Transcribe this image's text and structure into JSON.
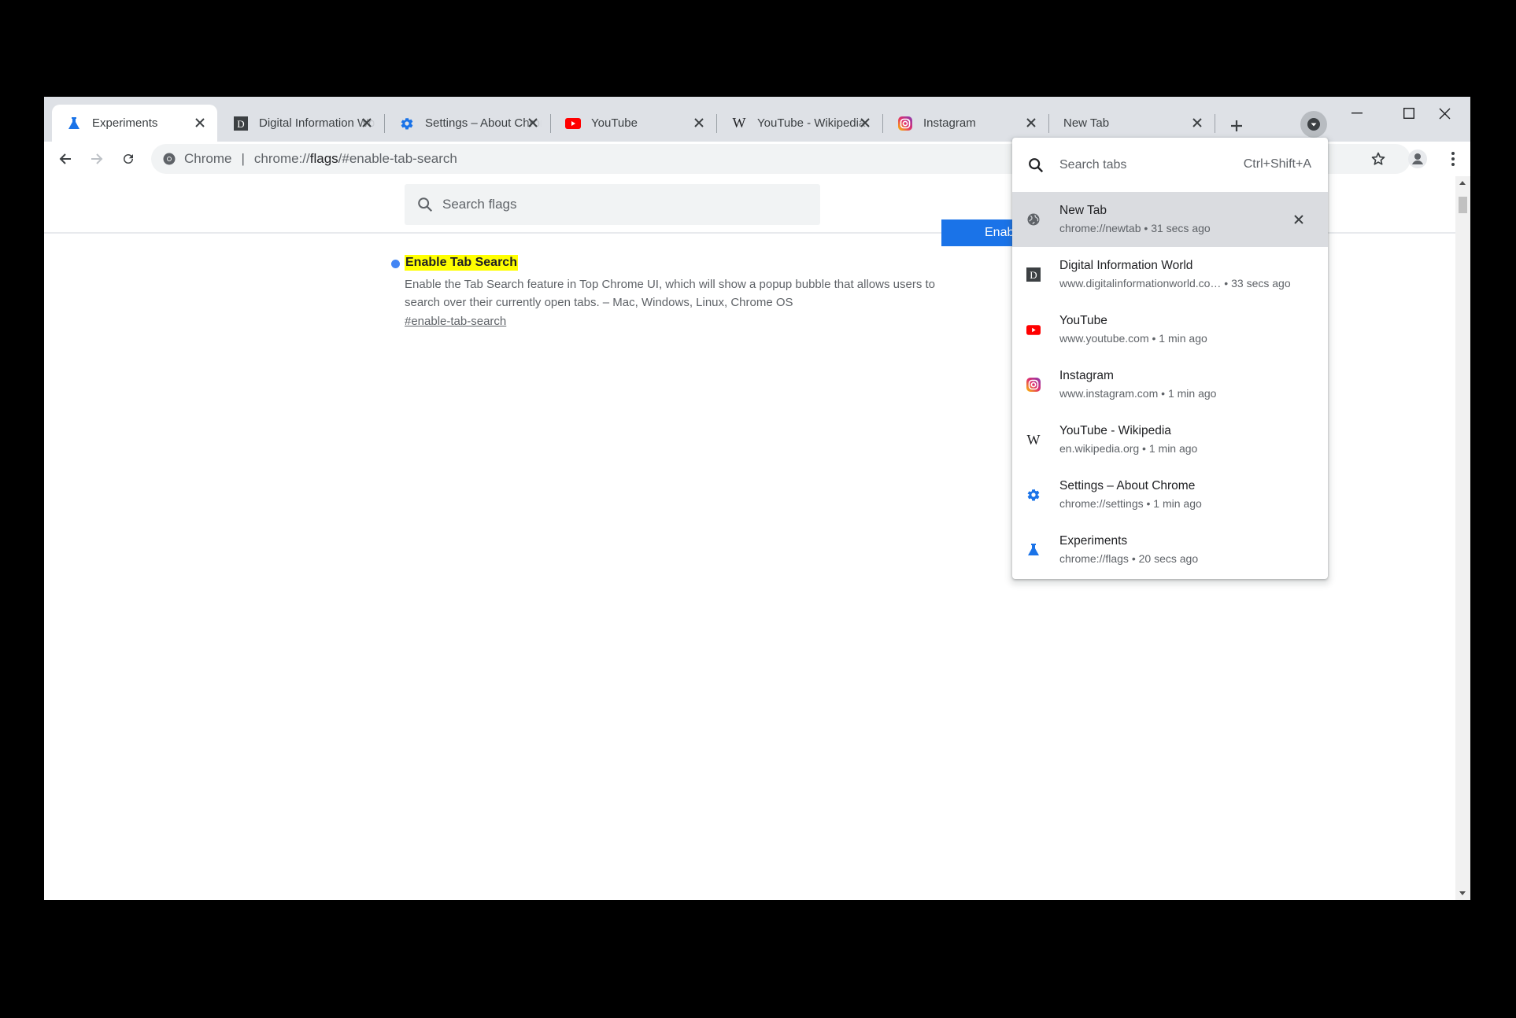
{
  "tabs": [
    {
      "title": "Experiments",
      "icon": "flask-icon",
      "active": true
    },
    {
      "title": "Digital Information World",
      "icon": "dgiw-icon"
    },
    {
      "title": "Settings – About Chrome",
      "icon": "gear-icon"
    },
    {
      "title": "YouTube",
      "icon": "youtube-icon"
    },
    {
      "title": "YouTube - Wikipedia",
      "icon": "wikipedia-icon"
    },
    {
      "title": "Instagram",
      "icon": "instagram-icon"
    },
    {
      "title": "New Tab",
      "icon": "none"
    }
  ],
  "omnibox": {
    "chip": "Chrome",
    "separator": "|",
    "url_prefix": "chrome://",
    "url_host": "flags",
    "url_suffix": "/#enable-tab-search"
  },
  "flags": {
    "search_placeholder": "Search flags",
    "entry": {
      "title": "Enable Tab Search",
      "description": "Enable the Tab Search feature in Top Chrome UI, which will show a popup bubble that allows users to search over their currently open tabs. – Mac, Windows, Linux, Chrome OS",
      "link": "#enable-tab-search",
      "select_value": "Enabled"
    }
  },
  "tab_search": {
    "placeholder": "Search tabs",
    "shortcut": "Ctrl+Shift+A",
    "results": [
      {
        "title": "New Tab",
        "url": "chrome://newtab",
        "time": "31 secs ago",
        "icon": "globe-icon",
        "selected": true
      },
      {
        "title": "Digital Information World",
        "url": "www.digitalinformationworld.co…",
        "time": "33 secs ago",
        "icon": "dgiw-icon"
      },
      {
        "title": "YouTube",
        "url": "www.youtube.com",
        "time": "1 min ago",
        "icon": "youtube-icon"
      },
      {
        "title": "Instagram",
        "url": "www.instagram.com",
        "time": "1 min ago",
        "icon": "instagram-icon"
      },
      {
        "title": "YouTube - Wikipedia",
        "url": "en.wikipedia.org",
        "time": "1 min ago",
        "icon": "wikipedia-icon"
      },
      {
        "title": "Settings – About Chrome",
        "url": "chrome://settings",
        "time": "1 min ago",
        "icon": "gear-icon"
      },
      {
        "title": "Experiments",
        "url": "chrome://flags",
        "time": "20 secs ago",
        "icon": "flask-icon"
      }
    ]
  },
  "colors": {
    "accent": "#1a73e8",
    "highlight": "#ffff00",
    "youtube_red": "#ff0000",
    "tabstrip_bg": "#dee1e6"
  }
}
